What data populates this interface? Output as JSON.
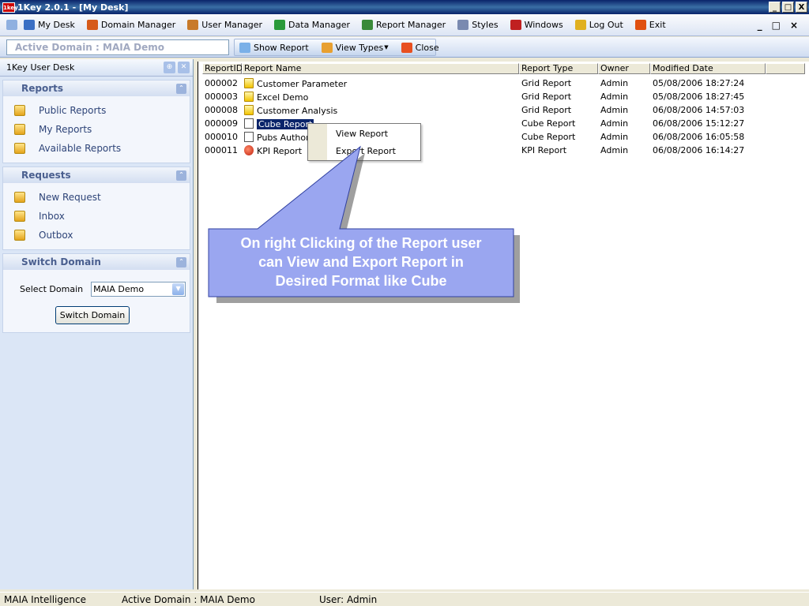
{
  "window": {
    "logo_text": "1key",
    "title": "1Key 2.0.1 - [My Desk]",
    "controls": [
      "_",
      "□",
      "X"
    ]
  },
  "menu": {
    "items": [
      {
        "label": "My Desk",
        "icon": "monitor-icon",
        "color": "#3a6fc4"
      },
      {
        "label": "Domain Manager",
        "icon": "domain-icon",
        "color": "#d65a1a"
      },
      {
        "label": "User Manager",
        "icon": "user-icon",
        "color": "#c87a2a"
      },
      {
        "label": "Data Manager",
        "icon": "data-icon",
        "color": "#2a9a3a"
      },
      {
        "label": "Report Manager",
        "icon": "report-icon",
        "color": "#3a8a3a"
      },
      {
        "label": "Styles",
        "icon": "styles-icon",
        "color": "#7a8ab0"
      },
      {
        "label": "Windows",
        "icon": "windows-icon",
        "color": "#c02020"
      },
      {
        "label": "Log Out",
        "icon": "logout-icon",
        "color": "#e0b020"
      },
      {
        "label": "Exit",
        "icon": "exit-icon",
        "color": "#e05010"
      }
    ],
    "mdi_controls": [
      "_",
      "□",
      "×"
    ]
  },
  "toolbar": {
    "active_domain": "Active Domain : MAIA Demo",
    "show_report": "Show Report",
    "view_types": "View Types",
    "close": "Close"
  },
  "left": {
    "header": "1Key User Desk",
    "reports": {
      "title": "Reports",
      "items": [
        "Public Reports",
        "My Reports",
        "Available Reports"
      ]
    },
    "requests": {
      "title": "Requests",
      "items": [
        "New Request",
        "Inbox",
        "Outbox"
      ]
    },
    "switch": {
      "title": "Switch Domain",
      "label": "Select Domain",
      "selected": "MAIA Demo",
      "button": "Switch Domain"
    }
  },
  "grid": {
    "columns": [
      "ReportID",
      "Report Name",
      "Report Type",
      "Owner",
      "Modified Date"
    ],
    "rows": [
      {
        "id": "000002",
        "name": "Customer Parameter",
        "type": "Grid Report",
        "owner": "Admin",
        "date": "05/08/2006 18:27:24",
        "icon": "grid"
      },
      {
        "id": "000003",
        "name": "Excel Demo",
        "type": "Grid Report",
        "owner": "Admin",
        "date": "05/08/2006 18:27:45",
        "icon": "grid"
      },
      {
        "id": "000008",
        "name": "Customer Analysis",
        "type": "Grid Report",
        "owner": "Admin",
        "date": "06/08/2006 14:57:03",
        "icon": "grid"
      },
      {
        "id": "000009",
        "name": "Cube Report",
        "type": "Cube Report",
        "owner": "Admin",
        "date": "06/08/2006 15:12:27",
        "icon": "cube",
        "selected": true
      },
      {
        "id": "000010",
        "name": "Pubs Author V",
        "type": "Cube Report",
        "owner": "Admin",
        "date": "06/08/2006 16:05:58",
        "icon": "cube"
      },
      {
        "id": "000011",
        "name": "KPI Report",
        "type": "KPI Report",
        "owner": "Admin",
        "date": "06/08/2006 16:14:27",
        "icon": "kpi"
      }
    ]
  },
  "context_menu": {
    "items": [
      "View Report",
      "Export Report"
    ]
  },
  "callout": {
    "lines": [
      "On right Clicking of the Report user",
      "can View and Export Report in",
      "Desired Format like Cube"
    ],
    "fill": "#9aa6f0"
  },
  "status": {
    "company": "MAIA Intelligence",
    "domain": "Active Domain : MAIA Demo",
    "user": "User: Admin"
  }
}
